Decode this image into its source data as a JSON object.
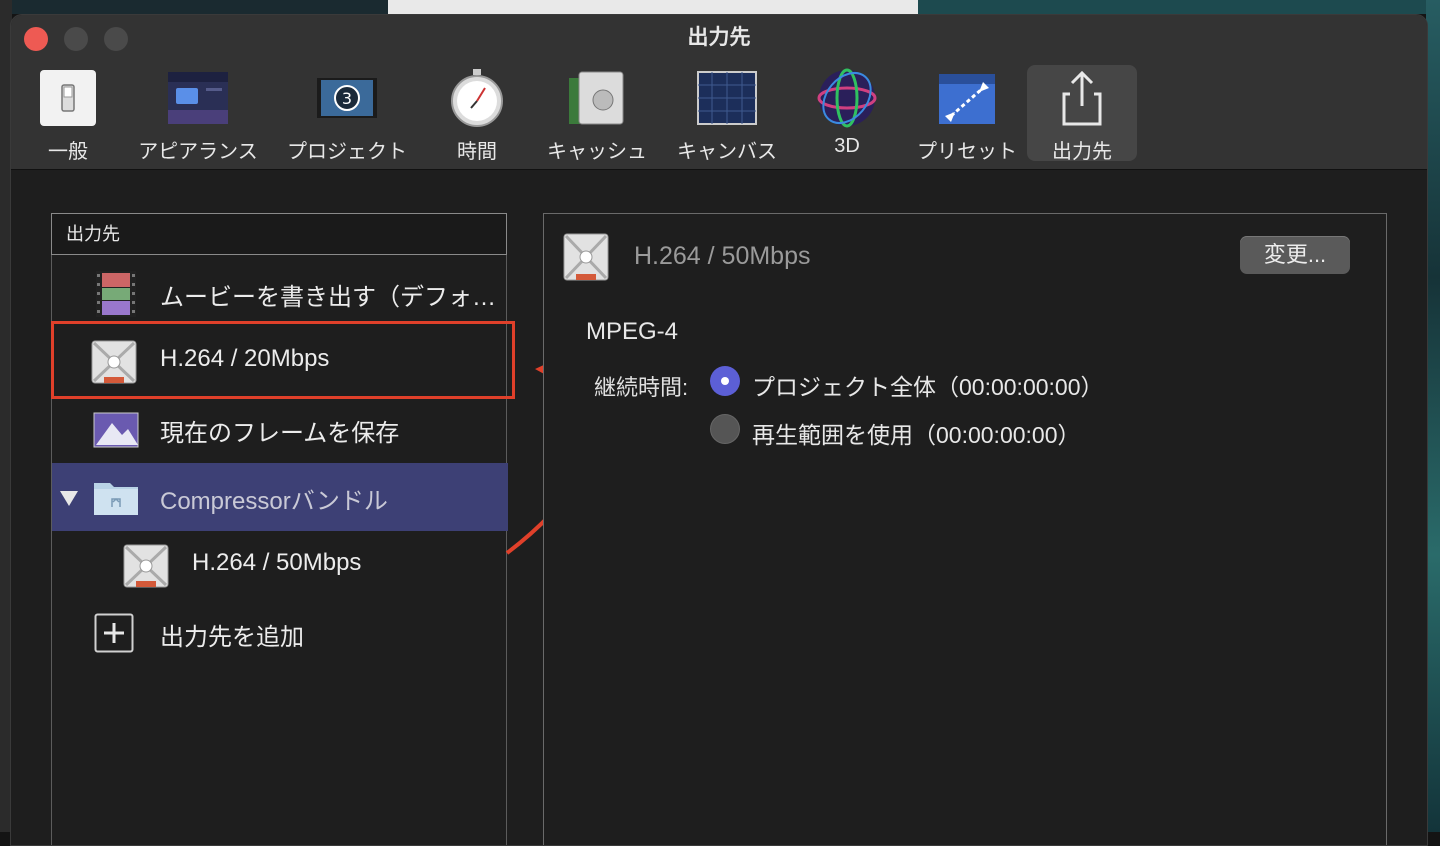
{
  "window": {
    "title": "出力先"
  },
  "toolbar": {
    "items": [
      {
        "label": "一般",
        "icon": "general-switch-icon"
      },
      {
        "label": "アピアランス",
        "icon": "appearance-icon"
      },
      {
        "label": "プロジェクト",
        "icon": "project-filmstrip-icon"
      },
      {
        "label": "時間",
        "icon": "stopwatch-icon"
      },
      {
        "label": "キャッシュ",
        "icon": "cache-drive-icon"
      },
      {
        "label": "キャンバス",
        "icon": "canvas-grid-icon"
      },
      {
        "label": "3D",
        "icon": "sphere-3d-icon"
      },
      {
        "label": "プリセット",
        "icon": "preset-icon"
      },
      {
        "label": "出力先",
        "icon": "share-icon",
        "active": true
      }
    ]
  },
  "destinations": {
    "header": "出力先",
    "items": [
      {
        "label": "ムービーを書き出す（デフォ…",
        "icon": "movie-film-icon"
      },
      {
        "label": "H.264 / 20Mbps",
        "icon": "compressor-icon"
      },
      {
        "label": "現在のフレームを保存",
        "icon": "mountain-image-icon"
      },
      {
        "label": "Compressorバンドル",
        "icon": "folder-icon",
        "selected": true,
        "expanded": true
      },
      {
        "label": "H.264 / 50Mbps",
        "icon": "compressor-icon",
        "child": true
      },
      {
        "label": "出力先を追加",
        "icon": "plus-icon"
      }
    ]
  },
  "detail": {
    "title": "H.264 / 50Mbps",
    "change_button": "変更...",
    "format": "MPEG-4",
    "duration_label": "継続時間:",
    "options": [
      {
        "label": "プロジェクト全体（00:00:00:00）",
        "selected": true
      },
      {
        "label": "再生範囲を使用（00:00:00:00）",
        "selected": false
      }
    ]
  },
  "colors": {
    "accent": "#5c5fd6",
    "selection": "#3d4075",
    "annotation": "#e0402a"
  }
}
